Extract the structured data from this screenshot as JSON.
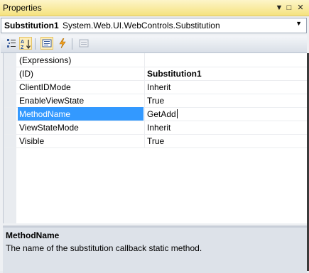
{
  "window": {
    "title": "Properties",
    "buttons": {
      "pin": "▼",
      "float": "□",
      "close": "✕"
    }
  },
  "object_selector": {
    "name": "Substitution1",
    "type": "System.Web.UI.WebControls.Substitution"
  },
  "toolbar": {
    "buttons": [
      {
        "icon": "categorized-icon",
        "state": "normal"
      },
      {
        "icon": "alphabetical-icon",
        "state": "checked"
      },
      {
        "icon": "properties-icon",
        "state": "checked"
      },
      {
        "icon": "events-icon",
        "state": "normal"
      },
      {
        "icon": "property-pages-icon",
        "state": "disabled"
      }
    ]
  },
  "properties": [
    {
      "name": "(Expressions)",
      "value": ""
    },
    {
      "name": "(ID)",
      "value": "Substitution1",
      "bold": true
    },
    {
      "name": "ClientIDMode",
      "value": "Inherit"
    },
    {
      "name": "EnableViewState",
      "value": "True"
    },
    {
      "name": "MethodName",
      "value": "GetAdd",
      "selected": true
    },
    {
      "name": "ViewStateMode",
      "value": "Inherit"
    },
    {
      "name": "Visible",
      "value": "True"
    }
  ],
  "description": {
    "title": "MethodName",
    "text": "The name of the substitution callback static method."
  },
  "colors": {
    "titlebar": "#f5e27e",
    "selection": "#3399ff"
  }
}
